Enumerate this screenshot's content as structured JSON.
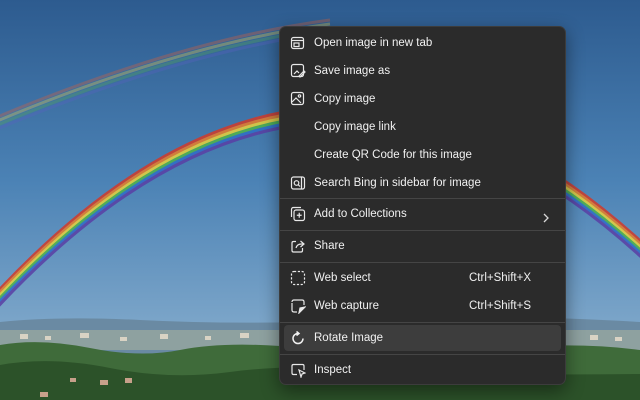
{
  "menu": {
    "items": [
      {
        "label": "Open image in new tab",
        "icon": "open-image-new-tab-icon"
      },
      {
        "label": "Save image as",
        "icon": "save-image-icon"
      },
      {
        "label": "Copy image",
        "icon": "copy-image-icon"
      },
      {
        "label": "Copy image link",
        "icon": ""
      },
      {
        "label": "Create QR Code for this image",
        "icon": ""
      },
      {
        "label": "Search Bing in sidebar for image",
        "icon": "search-sidebar-icon"
      },
      {
        "label": "Add to Collections",
        "icon": "add-collections-icon",
        "submenu": true
      },
      {
        "label": "Share",
        "icon": "share-icon"
      },
      {
        "label": "Web select",
        "icon": "web-select-icon",
        "shortcut": "Ctrl+Shift+X"
      },
      {
        "label": "Web capture",
        "icon": "web-capture-icon",
        "shortcut": "Ctrl+Shift+S"
      },
      {
        "label": "Rotate Image",
        "icon": "rotate-icon",
        "highlighted": true
      },
      {
        "label": "Inspect",
        "icon": "inspect-icon"
      }
    ]
  },
  "colors": {
    "menu_bg": "#2b2b2b",
    "menu_text": "#f1f1f1",
    "highlight": "#3d3d3d",
    "separator": "#454545"
  }
}
